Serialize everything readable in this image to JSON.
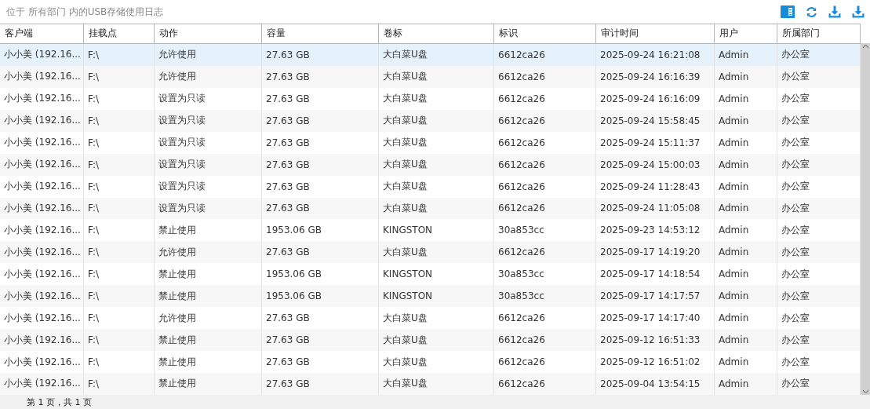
{
  "title": "位于 所有部门 内的USB存储使用日志",
  "toolbar": [
    {
      "kind": "panel"
    },
    {
      "kind": "refresh"
    },
    {
      "kind": "download"
    },
    {
      "kind": "download"
    }
  ],
  "table": {
    "columns": [
      "客户端",
      "挂载点",
      "动作",
      "容量",
      "卷标",
      "标识",
      "审计时间",
      "用户",
      "所属部门"
    ],
    "rows": [
      {
        "selected": true,
        "cells": [
          "小小美 (192.16...",
          "F:\\",
          "允许使用",
          "27.63 GB",
          "大白菜U盘",
          "6612ca26",
          "2025-09-24 16:21:08",
          "Admin",
          "办公室"
        ]
      },
      {
        "selected": false,
        "cells": [
          "小小美 (192.16...",
          "F:\\",
          "允许使用",
          "27.63 GB",
          "大白菜U盘",
          "6612ca26",
          "2025-09-24 16:16:39",
          "Admin",
          "办公室"
        ]
      },
      {
        "selected": false,
        "cells": [
          "小小美 (192.16...",
          "F:\\",
          "设置为只读",
          "27.63 GB",
          "大白菜U盘",
          "6612ca26",
          "2025-09-24 16:16:09",
          "Admin",
          "办公室"
        ]
      },
      {
        "selected": false,
        "cells": [
          "小小美 (192.16...",
          "F:\\",
          "设置为只读",
          "27.63 GB",
          "大白菜U盘",
          "6612ca26",
          "2025-09-24 15:58:45",
          "Admin",
          "办公室"
        ]
      },
      {
        "selected": false,
        "cells": [
          "小小美 (192.16...",
          "F:\\",
          "设置为只读",
          "27.63 GB",
          "大白菜U盘",
          "6612ca26",
          "2025-09-24 15:11:37",
          "Admin",
          "办公室"
        ]
      },
      {
        "selected": false,
        "cells": [
          "小小美 (192.16...",
          "F:\\",
          "设置为只读",
          "27.63 GB",
          "大白菜U盘",
          "6612ca26",
          "2025-09-24 15:00:03",
          "Admin",
          "办公室"
        ]
      },
      {
        "selected": false,
        "cells": [
          "小小美 (192.16...",
          "F:\\",
          "设置为只读",
          "27.63 GB",
          "大白菜U盘",
          "6612ca26",
          "2025-09-24 11:28:43",
          "Admin",
          "办公室"
        ]
      },
      {
        "selected": false,
        "cells": [
          "小小美 (192.16...",
          "F:\\",
          "设置为只读",
          "27.63 GB",
          "大白菜U盘",
          "6612ca26",
          "2025-09-24 11:05:08",
          "Admin",
          "办公室"
        ]
      },
      {
        "selected": false,
        "cells": [
          "小小美 (192.16...",
          "F:\\",
          "禁止使用",
          "1953.06 GB",
          "KINGSTON",
          "30a853cc",
          "2025-09-23 14:53:12",
          "Admin",
          "办公室"
        ]
      },
      {
        "selected": false,
        "cells": [
          "小小美 (192.16...",
          "F:\\",
          "允许使用",
          "27.63 GB",
          "大白菜U盘",
          "6612ca26",
          "2025-09-17 14:19:20",
          "Admin",
          "办公室"
        ]
      },
      {
        "selected": false,
        "cells": [
          "小小美 (192.16...",
          "F:\\",
          "禁止使用",
          "1953.06 GB",
          "KINGSTON",
          "30a853cc",
          "2025-09-17 14:18:54",
          "Admin",
          "办公室"
        ]
      },
      {
        "selected": false,
        "cells": [
          "小小美 (192.16...",
          "F:\\",
          "禁止使用",
          "1953.06 GB",
          "KINGSTON",
          "30a853cc",
          "2025-09-17 14:17:57",
          "Admin",
          "办公室"
        ]
      },
      {
        "selected": false,
        "cells": [
          "小小美 (192.16...",
          "F:\\",
          "允许使用",
          "27.63 GB",
          "大白菜U盘",
          "6612ca26",
          "2025-09-17 14:17:40",
          "Admin",
          "办公室"
        ]
      },
      {
        "selected": false,
        "cells": [
          "小小美 (192.16...",
          "F:\\",
          "禁止使用",
          "27.63 GB",
          "大白菜U盘",
          "6612ca26",
          "2025-09-12 16:51:33",
          "Admin",
          "办公室"
        ]
      },
      {
        "selected": false,
        "cells": [
          "小小美 (192.16...",
          "F:\\",
          "禁止使用",
          "27.63 GB",
          "大白菜U盘",
          "6612ca26",
          "2025-09-12 16:51:02",
          "Admin",
          "办公室"
        ]
      },
      {
        "selected": false,
        "cells": [
          "小小美 (192.16...",
          "F:\\",
          "禁止使用",
          "27.63 GB",
          "大白菜U盘",
          "6612ca26",
          "2025-09-04 13:54:15",
          "Admin",
          "办公室"
        ]
      }
    ]
  },
  "pager": "第 1 页，共 1 页"
}
